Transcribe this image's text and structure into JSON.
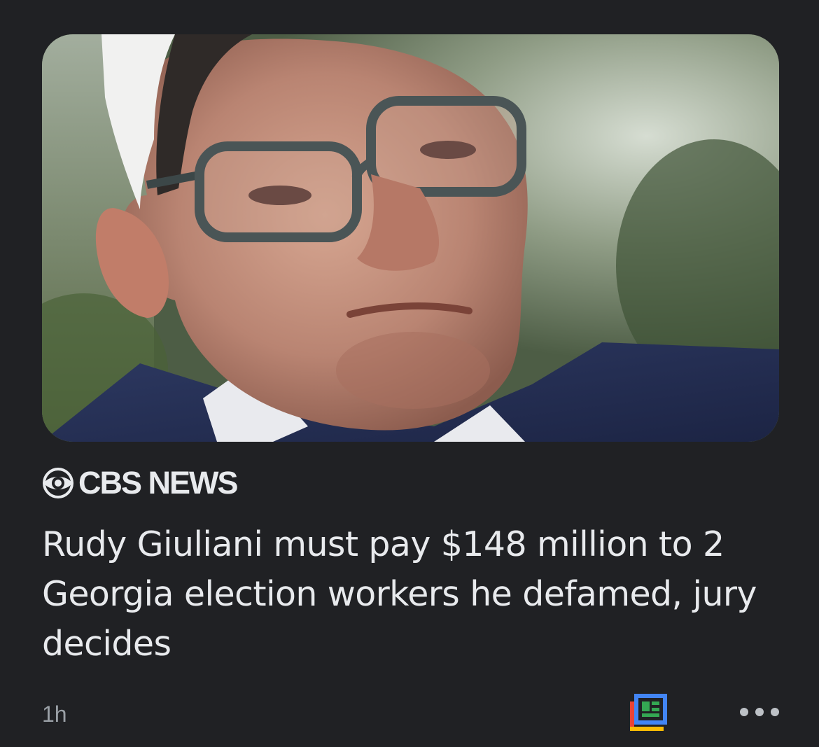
{
  "article": {
    "image_alt": "Rudy Giuliani",
    "source": "CBS NEWS",
    "headline": "Rudy Giuliani must pay $148 million to 2 Georgia election workers he defamed, jury decides",
    "time": "1h"
  },
  "icons": {
    "source_logo": "cbs-eye-icon",
    "full_coverage": "full-coverage-icon",
    "more": "more-horizontal-icon"
  },
  "colors": {
    "background": "#202124",
    "text": "#e8eaed",
    "secondary_text": "#9aa0a6",
    "google_blue": "#4285f4",
    "google_red": "#ea4335",
    "google_yellow": "#fbbc04",
    "google_green": "#34a853"
  }
}
